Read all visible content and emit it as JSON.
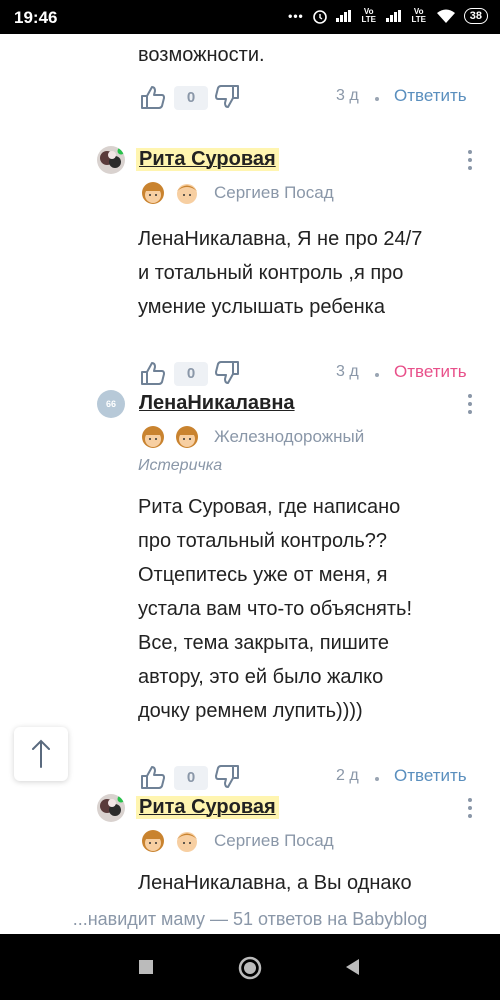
{
  "status_bar": {
    "time": "19:46",
    "net1": "Vo LTE",
    "net2": "Vo LTE",
    "battery": "38"
  },
  "comments": [
    {
      "text_lines": [
        "возможности."
      ],
      "likes": "0",
      "age": "3 д",
      "reply": "Ответить"
    },
    {
      "author": "Рита Суровая",
      "city": "Сергиев Посад",
      "text_lines": [
        "ЛенаНикалавна, Я не про 24/7",
        "и тотальный контроль ,я про",
        "умение услышать ребенка"
      ],
      "likes": "0",
      "age": "3 д",
      "reply": "Ответить"
    },
    {
      "author": "ЛенаНикалавна",
      "avatar_badge": "66",
      "city": "Железнодорожный",
      "user_status": "Истеричка",
      "text_lines": [
        "Рита Суровая, где написано",
        "про тотальный контроль??",
        "Отцепитесь уже от меня, я",
        "устала вам что-то объяснять!",
        "Все, тема закрыта, пишите",
        "автору, это ей было жалко",
        "дочку ремнем лупить))))"
      ],
      "likes": "0",
      "age": "2 д",
      "reply": "Ответить"
    },
    {
      "author": "Рита Суровая",
      "city": "Сергиев Посад",
      "text_lines": [
        "ЛенаНикалавна, а Вы однако"
      ]
    }
  ],
  "footer": {
    "thread_title": "...навидит маму — 51 ответов на Babyblog"
  },
  "colors": {
    "accent_link": "#5a8fbe",
    "reply_active": "#e8508a",
    "highlight": "#fff5b0",
    "muted": "#8a97a8"
  },
  "icons": [
    "thumb-up-icon",
    "thumb-down-icon",
    "kebab-menu-icon",
    "arrow-up-icon",
    "girl-child-icon",
    "boy-child-icon"
  ]
}
